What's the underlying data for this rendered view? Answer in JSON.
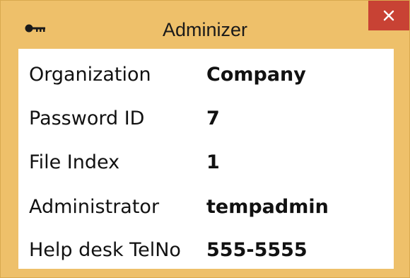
{
  "window": {
    "title": "Adminizer",
    "app_icon": "key-icon",
    "close_icon": "close-icon",
    "close_symbol": "✕"
  },
  "fields": [
    {
      "label": "Organization",
      "value": "Company"
    },
    {
      "label": "Password ID",
      "value": "7"
    },
    {
      "label": "File Index",
      "value": "1"
    },
    {
      "label": "Administrator",
      "value": "tempadmin"
    },
    {
      "label": "Help desk TelNo",
      "value": "555-5555"
    }
  ],
  "colors": {
    "frame": "#eec06a",
    "close_button": "#c84234",
    "content_background": "#ffffff",
    "text": "#111111"
  }
}
